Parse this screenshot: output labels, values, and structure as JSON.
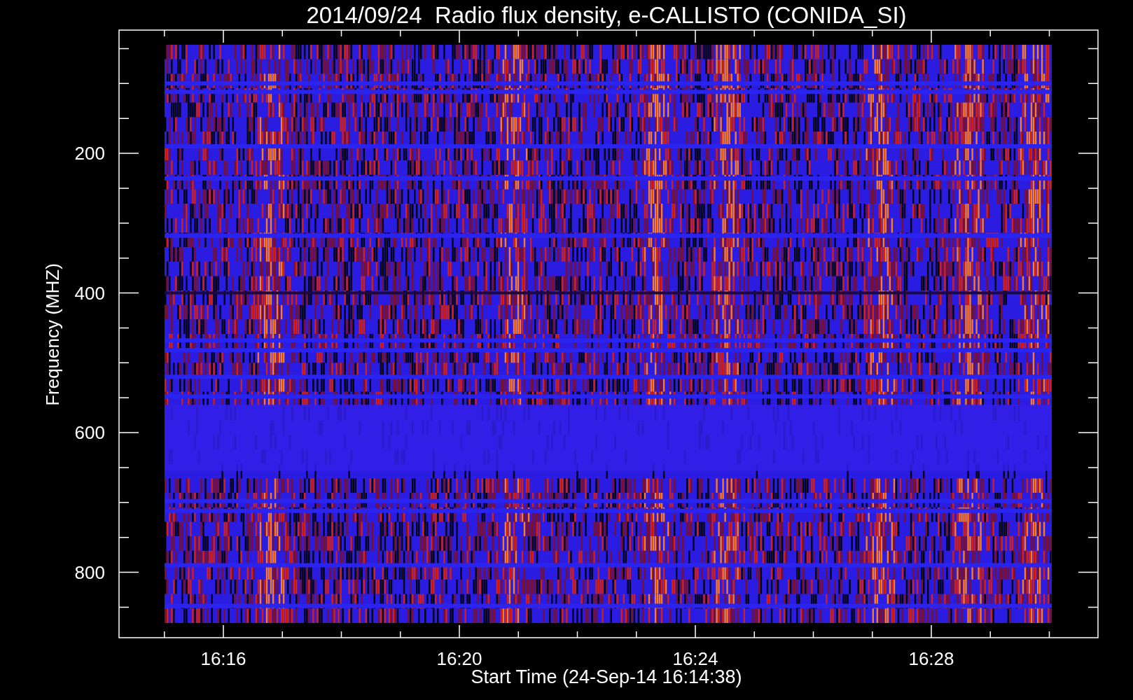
{
  "title": "2014/09/24  Radio flux density, e-CALLISTO (CONIDA_SI)",
  "y_axis": {
    "label": "Frequency (MHZ)",
    "ticks": [
      "200",
      "400",
      "600",
      "800"
    ]
  },
  "x_axis": {
    "label": "Start Time (24-Sep-14 16:14:38)",
    "ticks": [
      "16:16",
      "16:20",
      "16:24",
      "16:28"
    ]
  }
}
